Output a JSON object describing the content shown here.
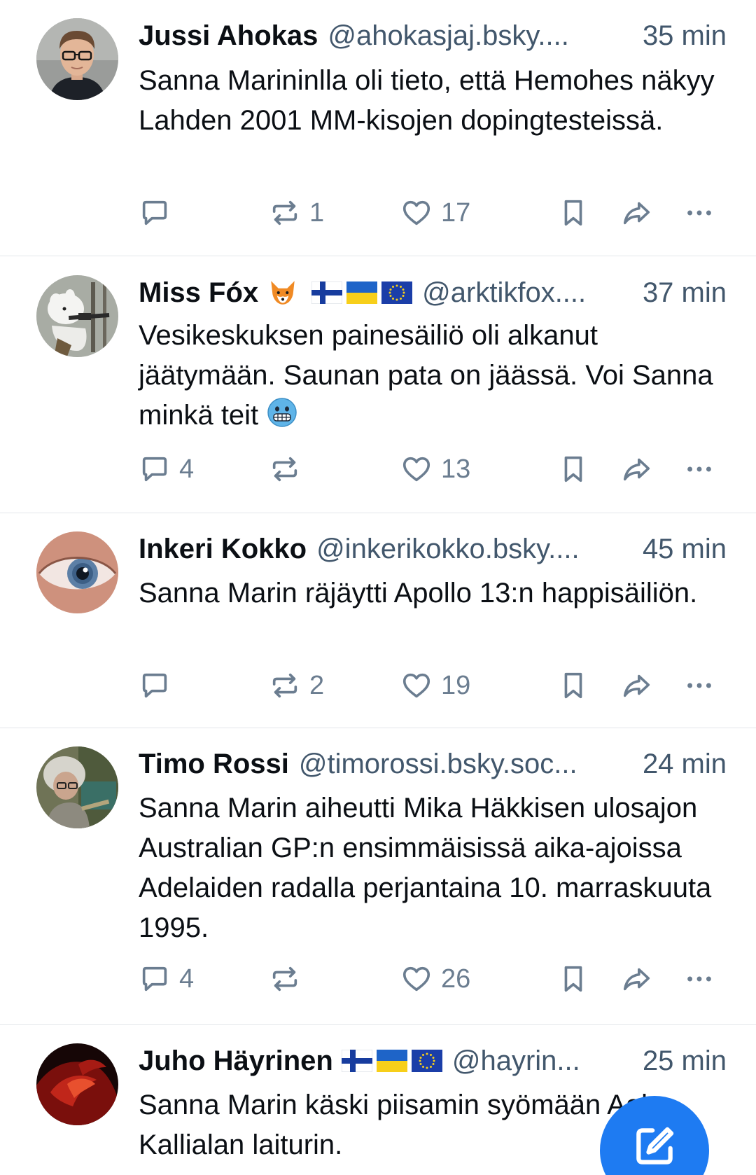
{
  "posts": [
    {
      "name": "Jussi Ahokas",
      "handle": "@ahokasjaj.bsky....",
      "time": "35 min",
      "text": "Sanna Marininlla oli tieto, että Hemohes näkyy Lahden 2001 MM-kisojen dopingtesteissä.",
      "replies": "",
      "reposts": "1",
      "likes": "17"
    },
    {
      "name": "Miss Fóx",
      "handle": "@arktikfox....",
      "time": "37 min",
      "text": "Vesikeskuksen painesäiliö oli alkanut jäätymään. Saunan pata on jäässä. Voi Sanna minkä teit",
      "replies": "4",
      "reposts": "",
      "likes": "13"
    },
    {
      "name": "Inkeri Kokko",
      "handle": "@inkerikokko.bsky....",
      "time": "45 min",
      "text": "Sanna Marin räjäytti Apollo 13:n happisäiliön.",
      "replies": "",
      "reposts": "2",
      "likes": "19"
    },
    {
      "name": "Timo Rossi",
      "handle": "@timorossi.bsky.soc...",
      "time": "24 min",
      "text": "Sanna Marin aiheutti Mika Häkkisen ulosajon Australian GP:n ensimmäisissä aika-ajoissa Adelaiden radalla perjantaina 10. marraskuuta 1995.",
      "replies": "4",
      "reposts": "",
      "likes": "26"
    },
    {
      "name": "Juho Häyrinen",
      "handle": "@hayrin...",
      "time": "25 min",
      "text": "Sanna Marin käski piisamin syömään Aake Kallialan laiturin.",
      "replies": "",
      "reposts": "",
      "likes": ""
    }
  ],
  "icons": {
    "reply": "speech-bubble-icon",
    "repost": "repost-arrows-icon",
    "like": "heart-icon",
    "bookmark": "bookmark-icon",
    "share": "share-arrow-icon",
    "more": "ellipsis-icon",
    "compose": "compose-pencil-icon"
  },
  "colors": {
    "text": "#0b0f14",
    "muted": "#42576c",
    "icon": "#6b7d90",
    "accent": "#1e7bf2",
    "divider": "#e3e6ea"
  }
}
